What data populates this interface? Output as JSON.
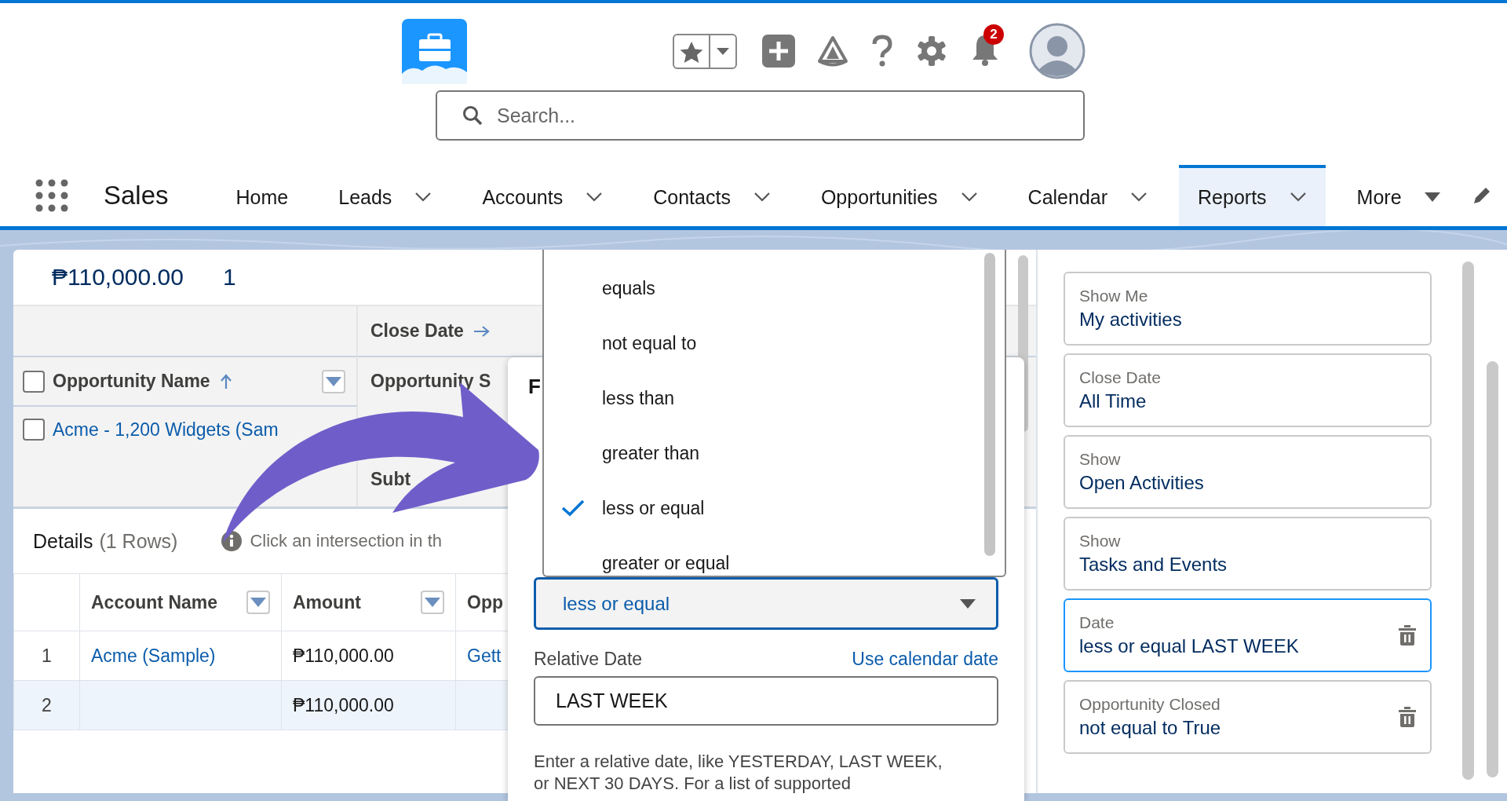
{
  "header": {
    "search": {
      "placeholder": "Search..."
    },
    "notifications": {
      "count": "2"
    }
  },
  "nav": {
    "app_name": "Sales",
    "tabs": [
      {
        "label": "Home",
        "kind": "plain",
        "selected": false
      },
      {
        "label": "Leads",
        "kind": "menu",
        "selected": false
      },
      {
        "label": "Accounts",
        "kind": "menu",
        "selected": false
      },
      {
        "label": "Contacts",
        "kind": "menu",
        "selected": false
      },
      {
        "label": "Opportunities",
        "kind": "menu",
        "selected": false
      },
      {
        "label": "Calendar",
        "kind": "menu",
        "selected": false
      },
      {
        "label": "Reports",
        "kind": "menu",
        "selected": true
      },
      {
        "label": "More",
        "kind": "more",
        "selected": false
      }
    ]
  },
  "summary": {
    "amount": "₱110,000.00",
    "count": "1"
  },
  "matrix": {
    "column_group": "Close Date",
    "row_header": "Opportunity Name",
    "header_checked": false,
    "column_header": "Opportunity S",
    "rows": [
      {
        "name": "Acme - 1,200 Widgets (Sam",
        "checked": false
      }
    ],
    "subtotal_label": "Subt"
  },
  "details": {
    "title": "Details",
    "row_count": "(1 Rows)",
    "hint": "Click an intersection in th",
    "columns": [
      "Account Name",
      "Amount",
      "Opp"
    ],
    "rows": [
      {
        "kind": "record",
        "number": "1",
        "account": "Acme (Sample)",
        "amount": "₱110,000.00",
        "opportunity": "Gett"
      },
      {
        "kind": "total",
        "number": "2",
        "amount": "₱110,000.00"
      }
    ]
  },
  "filter_popover": {
    "title_fragment": "F",
    "options": [
      {
        "label": "equals",
        "selected": false
      },
      {
        "label": "not equal to",
        "selected": false
      },
      {
        "label": "less than",
        "selected": false
      },
      {
        "label": "greater than",
        "selected": false
      },
      {
        "label": "less or equal",
        "selected": true
      },
      {
        "label": "greater or equal",
        "selected": false
      }
    ],
    "operator": "less or equal",
    "relative_date_label": "Relative Date",
    "calendar_link": "Use calendar date",
    "relative_date": "LAST WEEK",
    "help": "Enter a relative date, like YESTERDAY, LAST WEEK, or NEXT 30 DAYS. For a list of supported"
  },
  "filters": [
    {
      "label": "Show Me",
      "value": "My activities",
      "selected": false,
      "removable": false
    },
    {
      "label": "Close Date",
      "value": "All Time",
      "selected": false,
      "removable": false
    },
    {
      "label": "Show",
      "value": "Open Activities",
      "selected": false,
      "removable": false
    },
    {
      "label": "Show",
      "value": "Tasks and Events",
      "selected": false,
      "removable": false
    },
    {
      "label": "Date",
      "value": "less or equal LAST WEEK",
      "selected": true,
      "removable": true
    },
    {
      "label": "Opportunity Closed",
      "value": "not equal to True",
      "selected": false,
      "removable": true
    }
  ]
}
